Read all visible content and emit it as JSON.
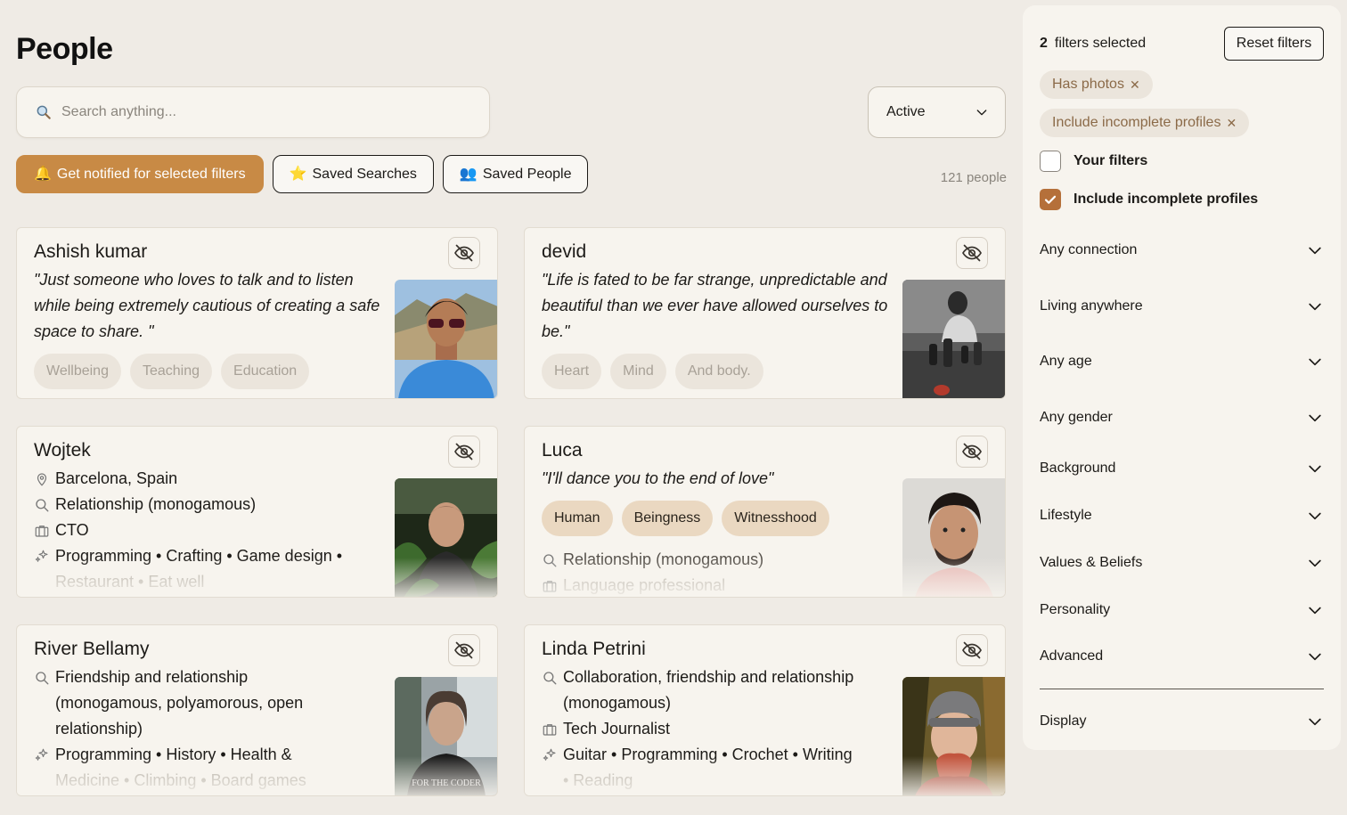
{
  "page": {
    "title": "People"
  },
  "search": {
    "placeholder": "Search anything..."
  },
  "status_select": {
    "value": "Active"
  },
  "actions": {
    "notify_label": "Get notified for selected filters",
    "saved_searches_label": "Saved Searches",
    "saved_people_label": "Saved People"
  },
  "people_count": "121 people",
  "cards": [
    {
      "name": "Ashish kumar",
      "quote": "\"Just someone who loves to talk and to listen while being extremely cautious of creating a safe space to share. \"",
      "tags": [
        "Wellbeing",
        "Teaching",
        "Education"
      ]
    },
    {
      "name": "devid",
      "quote": "\"Life is fated to be far strange, unpredictable and beautiful than we ever have allowed ourselves to be.\"",
      "tags": [
        "Heart",
        "Mind",
        "And body."
      ]
    },
    {
      "name": "Wojtek",
      "location": "Barcelona, Spain",
      "relationship": "Relationship (monogamous)",
      "job": "CTO",
      "interests_line1": "Programming • Crafting • Game design •",
      "interests_line2": "Restaurant • Eat well"
    },
    {
      "name": "Luca",
      "quote": "\"I'll dance you to the end of love\"",
      "tags": [
        "Human",
        "Beingness",
        "Witnesshood"
      ],
      "relationship": "Relationship (monogamous)",
      "job": "Language professional"
    },
    {
      "name": "River Bellamy",
      "relationship_line1": "Friendship and relationship",
      "relationship_line2": "(monogamous, polyamorous, open",
      "relationship_line3": "relationship)",
      "interests_line1": "Programming • History • Health &",
      "interests_line2": "Medicine • Climbing • Board games",
      "shirt_text": "FOR THE CODER"
    },
    {
      "name": "Linda Petrini",
      "relationship_line1": "Collaboration, friendship and relationship",
      "relationship_line2": "(monogamous)",
      "job": "Tech Journalist",
      "interests_line1": "Guitar • Programming • Crochet • Writing",
      "interests_line2": "• Reading"
    }
  ],
  "sidebar": {
    "filters_count_number": "2",
    "filters_count_label": "filters selected",
    "reset_label": "Reset filters",
    "chips": [
      "Has photos",
      "Include incomplete profiles"
    ],
    "checkboxes": [
      {
        "label": "Your filters",
        "checked": false
      },
      {
        "label": "Include incomplete profiles",
        "checked": true
      }
    ],
    "accordions": [
      "Any connection",
      "Living anywhere",
      "Any age",
      "Any gender",
      "Background",
      "Lifestyle",
      "Values & Beliefs",
      "Personality",
      "Advanced"
    ],
    "display_label": "Display"
  },
  "colors": {
    "accent": "#c88a45",
    "checkbox": "#b5703a",
    "background": "#efebe5",
    "card": "#f7f4ee"
  }
}
